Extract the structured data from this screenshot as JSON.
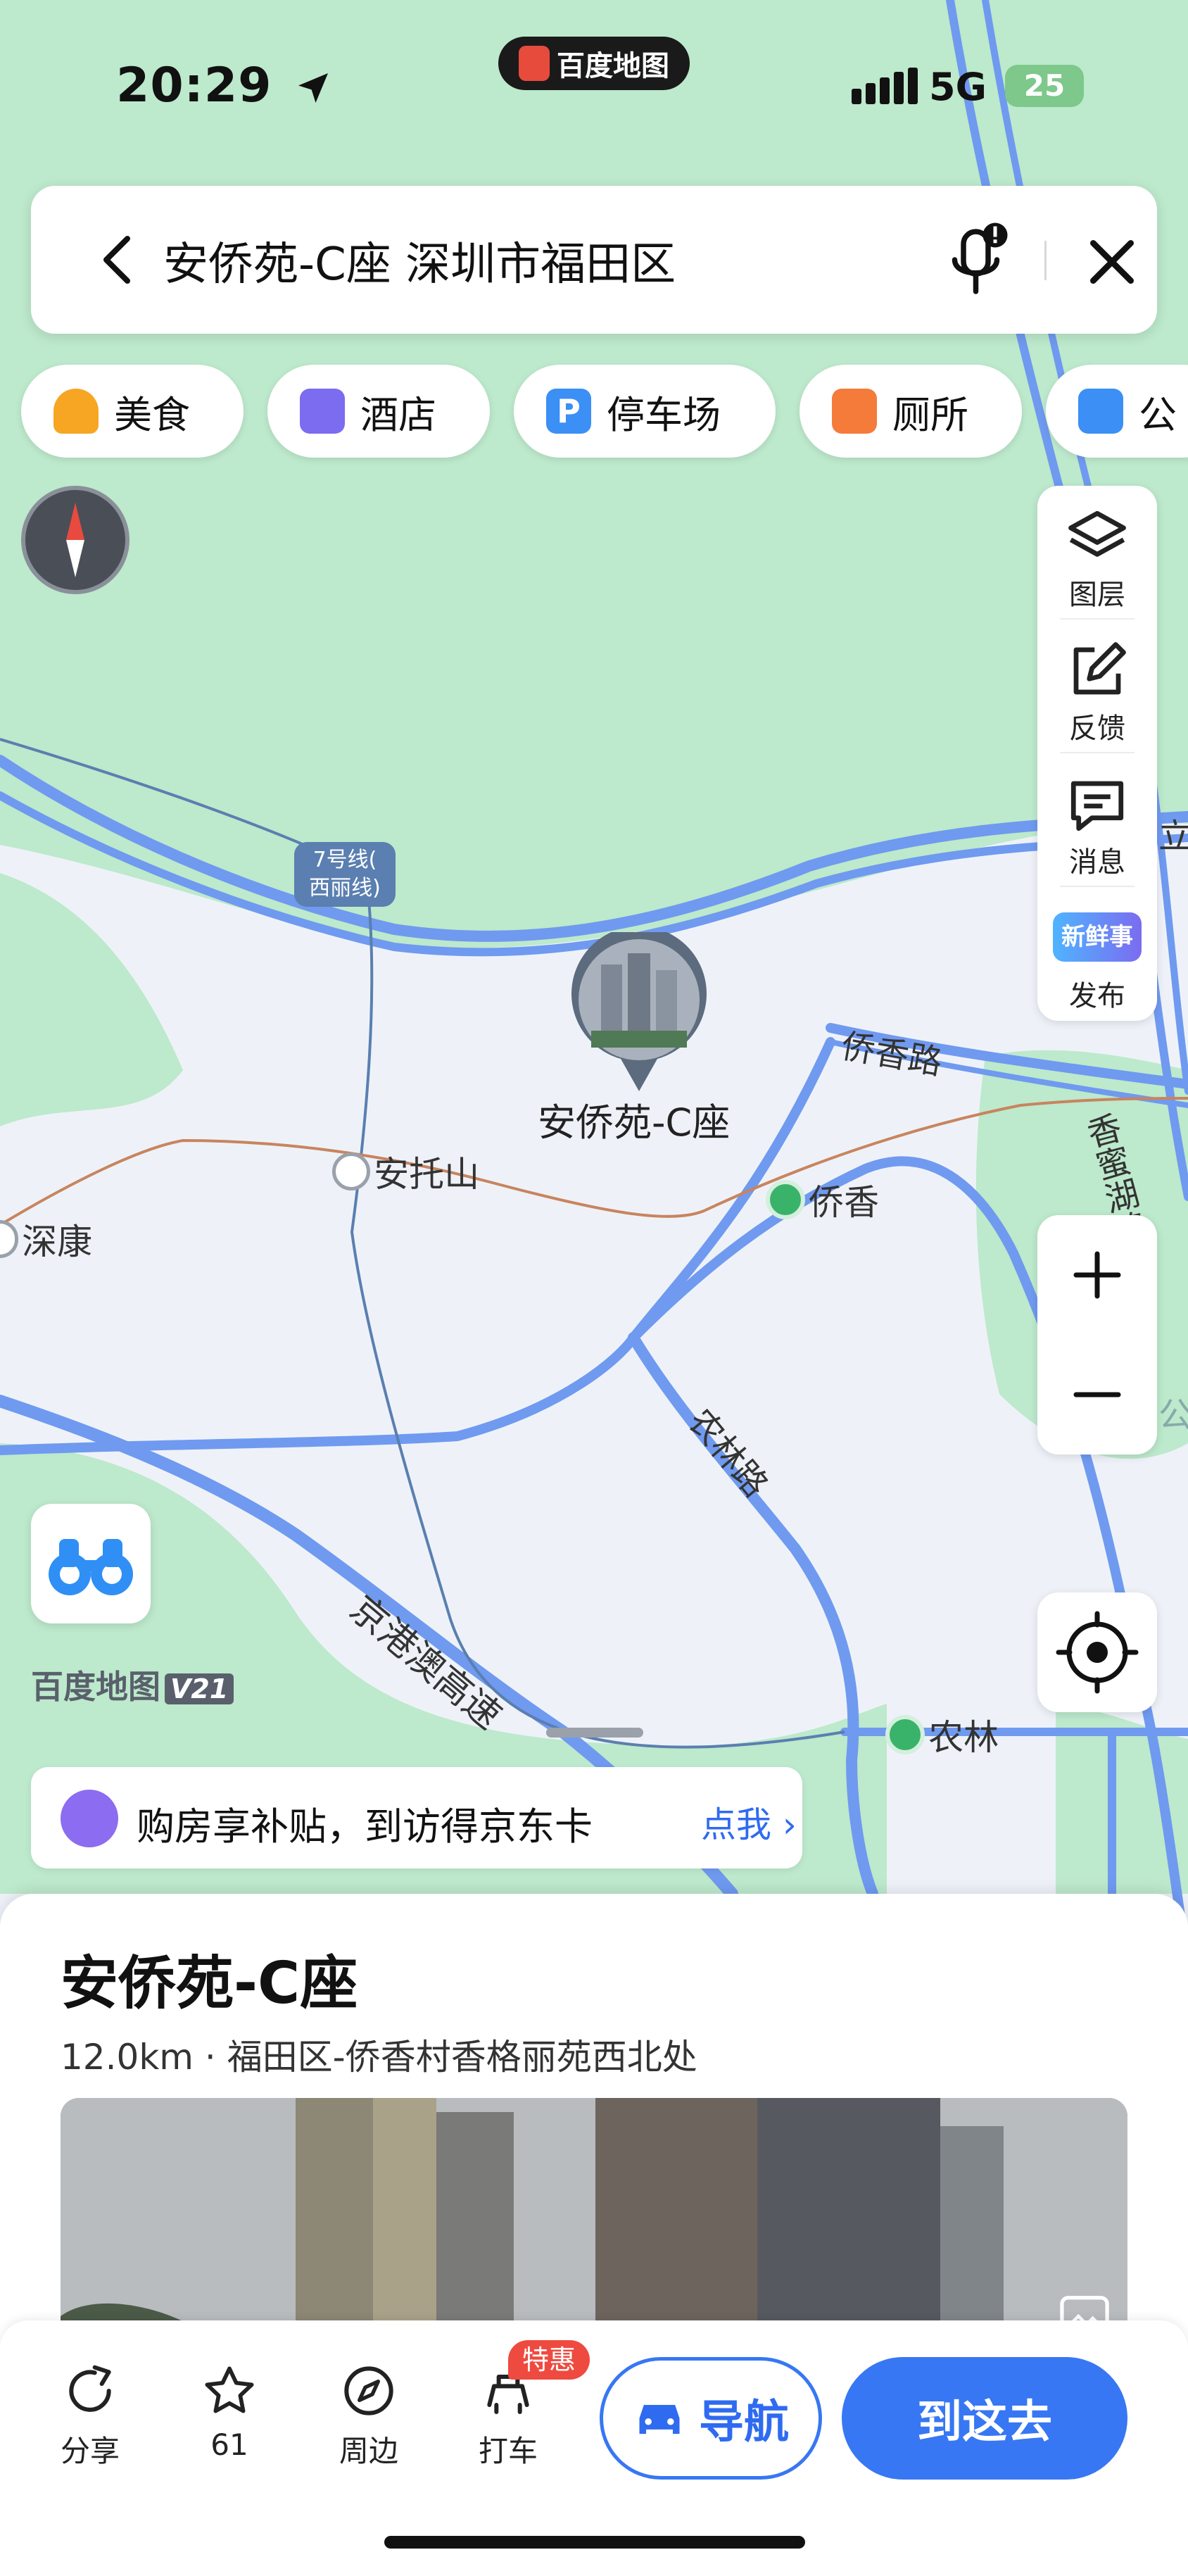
{
  "status_bar": {
    "time": "20:29",
    "network": "5G",
    "battery": "25",
    "app_name": "百度地图"
  },
  "search": {
    "query": "安侨苑-C座 深圳市福田区"
  },
  "categories": [
    {
      "label": "美食",
      "icon": "food-icon",
      "color": "#f6a623"
    },
    {
      "label": "酒店",
      "icon": "hotel-icon",
      "color": "#7b6cf0"
    },
    {
      "label": "停车场",
      "icon": "parking-icon",
      "color": "#3b8ff5"
    },
    {
      "label": "厕所",
      "icon": "toilet-icon",
      "color": "#f57b3b"
    },
    {
      "label": "公",
      "icon": "bus-icon",
      "color": "#3b8ff5"
    }
  ],
  "map_tools": {
    "layers": "图层",
    "feedback": "反馈",
    "messages": "消息",
    "publish": "发布",
    "publish_badge": "新鲜事"
  },
  "map_labels": {
    "metro_line": "7号线(西丽线)",
    "metro_line_1": "7号线(",
    "metro_line_2": "西丽线)",
    "poi": "安侨苑-C座",
    "station_antuoshan": "安托山",
    "station_qiaoxiang": "侨香",
    "station_shenkang": "深康",
    "station_nonglin": "农林",
    "road_qiaoxiang": "侨香路",
    "road_nonglin": "农林路",
    "road_xiangmi": "香蜜湖路",
    "road_expressway": "京港澳高速",
    "edge_right_1": "立",
    "edge_right_2": "公"
  },
  "watermark": {
    "brand": "百度地图",
    "version": "V21"
  },
  "promo": {
    "text": "购房享补贴，到访得京东卡",
    "cta": "点我"
  },
  "place": {
    "name": "安侨苑-C座",
    "distance": "12.0km",
    "address": "福田区-侨香村香格丽苑西北处"
  },
  "actions": {
    "share": "分享",
    "favorite_count": "61",
    "nearby": "周边",
    "taxi": "打车",
    "taxi_badge": "特惠",
    "navigate": "导航",
    "go": "到这去"
  },
  "colors": {
    "accent": "#3777f3",
    "map_green": "#bde9cc",
    "map_land": "#eef2f8",
    "road": "#6f9af0"
  }
}
